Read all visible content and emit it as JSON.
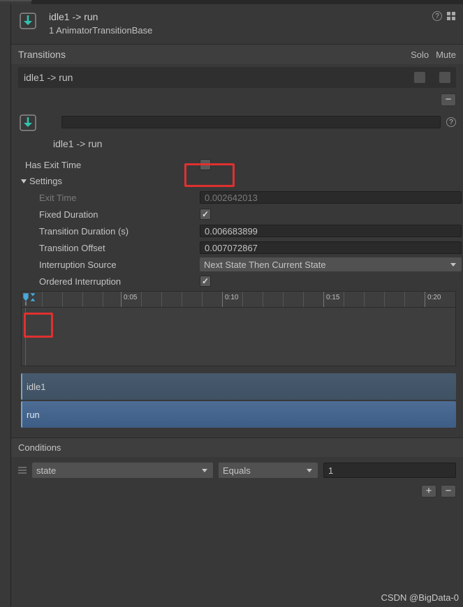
{
  "header": {
    "title": "idle1 -> run",
    "subtitle": "1 AnimatorTransitionBase"
  },
  "transitions": {
    "header": "Transitions",
    "col_solo": "Solo",
    "col_mute": "Mute",
    "items": [
      {
        "label": "idle1 -> run"
      }
    ]
  },
  "detail": {
    "name_label": "idle1 -> run"
  },
  "props": {
    "has_exit_time_label": "Has Exit Time",
    "settings_label": "Settings",
    "exit_time_label": "Exit Time",
    "exit_time_value": "0.002642013",
    "fixed_duration_label": "Fixed Duration",
    "duration_label": "Transition Duration (s)",
    "duration_value": "0.006683899",
    "offset_label": "Transition Offset",
    "offset_value": "0.007072867",
    "interruption_label": "Interruption Source",
    "interruption_value": "Next State Then Current State",
    "ordered_label": "Ordered Interruption"
  },
  "timeline": {
    "ticks": [
      "0:05",
      "0:10",
      "0:15",
      "0:20"
    ],
    "clip_a": "idle1",
    "clip_b": "run"
  },
  "conditions": {
    "header": "Conditions",
    "rows": [
      {
        "param": "state",
        "mode": "Equals",
        "value": "1"
      }
    ]
  },
  "watermark": "CSDN @BigData-0"
}
